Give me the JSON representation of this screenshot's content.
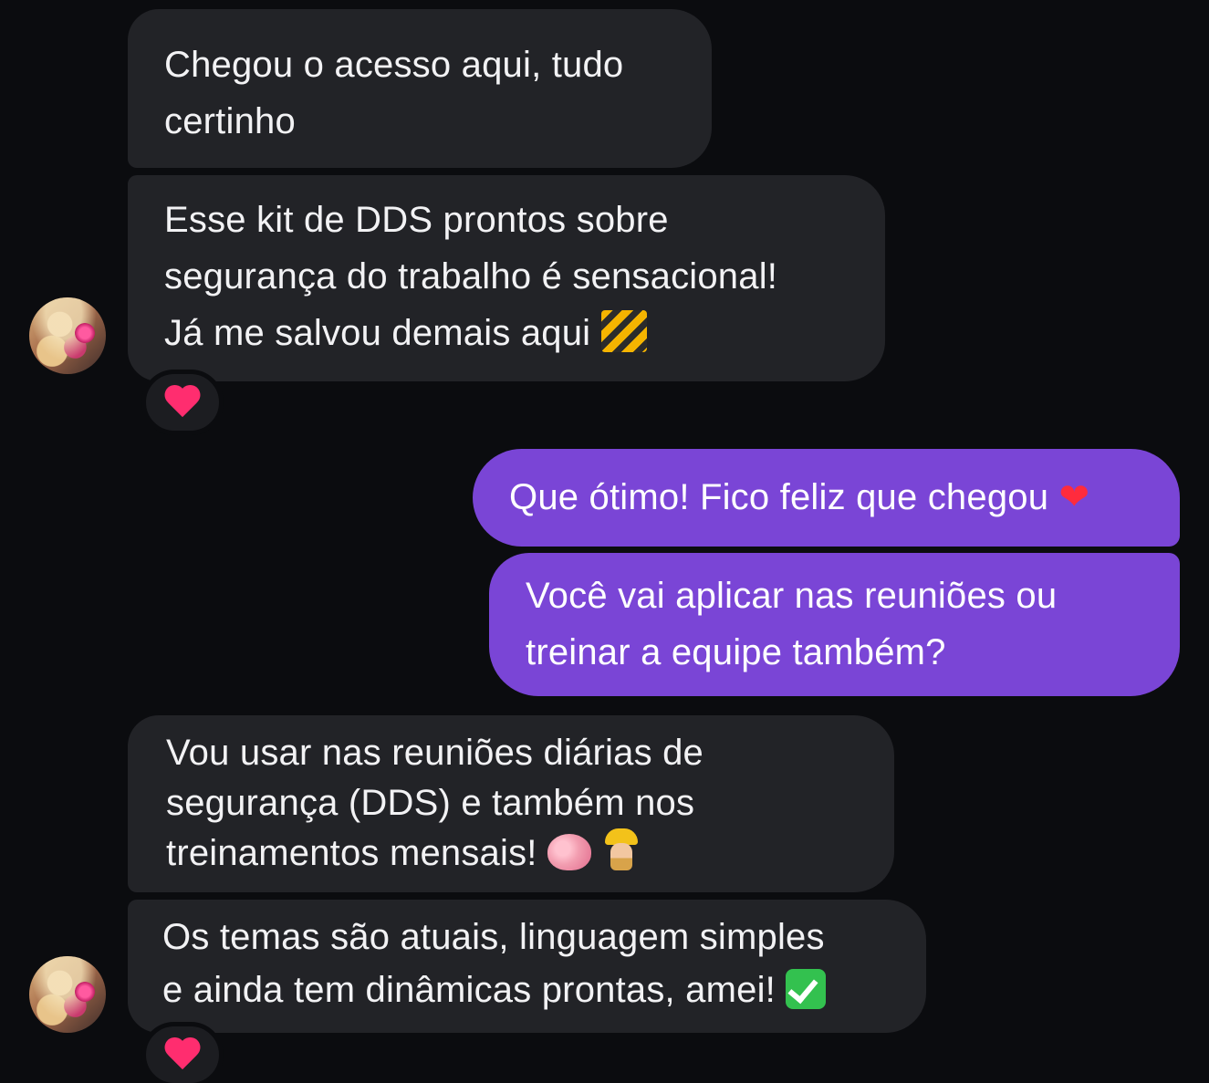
{
  "messages": [
    {
      "id": "m1",
      "direction": "incoming",
      "lines": [
        "Chegou o acesso aqui, tudo",
        "certinho"
      ]
    },
    {
      "id": "m2",
      "direction": "incoming",
      "lines": [
        "Esse kit de DDS prontos sobre",
        "segurança do trabalho é sensacional!",
        "Já me salvou demais aqui"
      ],
      "emoji": "construction-icon",
      "reaction": "heart"
    },
    {
      "id": "m3",
      "direction": "outgoing",
      "lines": [
        "Que ótimo! Fico feliz que chegou"
      ],
      "emoji": "red-heart-icon",
      "emoji_glyph": "❤"
    },
    {
      "id": "m4",
      "direction": "outgoing",
      "lines": [
        "Você vai aplicar nas reuniões ou",
        "treinar a equipe também?"
      ]
    },
    {
      "id": "m5",
      "direction": "incoming",
      "lines": [
        "Vou usar nas reuniões diárias de",
        "segurança (DDS) e também nos",
        "treinamentos mensais!"
      ],
      "emoji": "brain-icon worker-icon"
    },
    {
      "id": "m6",
      "direction": "incoming",
      "lines": [
        "Os temas são atuais, linguagem simples",
        "e ainda tem dinâmicas prontas, amei!"
      ],
      "emoji": "check-mark-icon",
      "reaction": "heart"
    }
  ],
  "colors": {
    "background": "#0b0c0f",
    "incoming_bubble": "#222327",
    "outgoing_bubble": "#7a45d6",
    "reaction_heart": "#ff2d6f"
  }
}
